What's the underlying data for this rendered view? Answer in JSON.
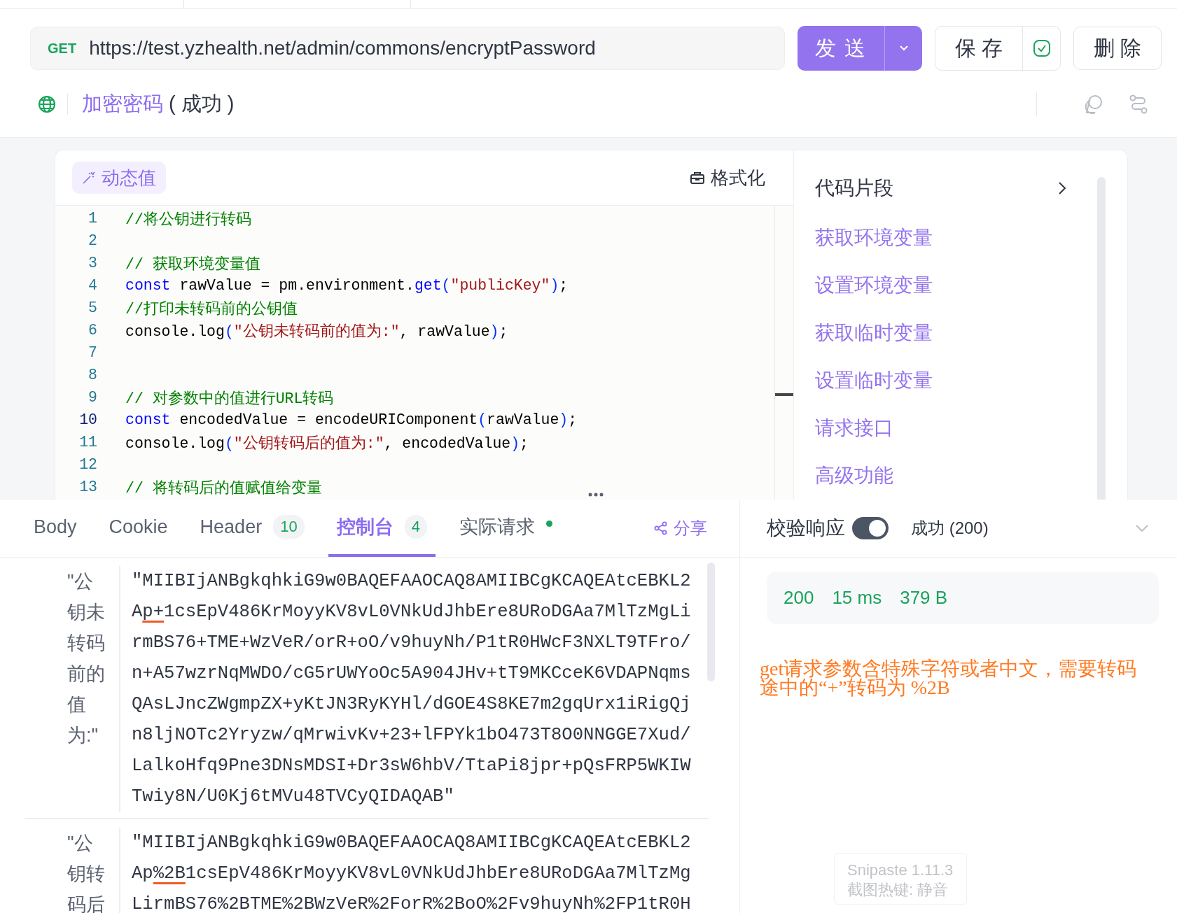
{
  "request": {
    "method": "GET",
    "url": "https://test.yzhealth.net/admin/commons/encryptPassword",
    "send_label": "发 送",
    "save_label": "保 存",
    "delete_label": "删 除",
    "saved": true
  },
  "title": {
    "name": "加密密码",
    "status": "( 成功 )"
  },
  "editor": {
    "dynamic_label": "动态值",
    "format_label": "格式化",
    "lines": [
      {
        "number": "1",
        "current": false,
        "tokens": [
          {
            "kind": "comment",
            "text": "//将公钥进行转码"
          }
        ]
      },
      {
        "number": "2",
        "current": false
      },
      {
        "number": "3",
        "current": false,
        "tokens": [
          {
            "kind": "comment",
            "text": "// 获取环境变量值"
          }
        ]
      },
      {
        "number": "4",
        "current": false,
        "tokens": [
          {
            "kind": "keyword",
            "text": "const"
          },
          {
            "kind": "plain",
            "text": " rawValue = pm.environment."
          },
          {
            "kind": "func",
            "text": "get"
          },
          {
            "kind": "paren",
            "text": "("
          },
          {
            "kind": "string",
            "text": "\"publicKey\""
          },
          {
            "kind": "paren",
            "text": ")"
          },
          {
            "kind": "plain",
            "text": ";"
          }
        ]
      },
      {
        "number": "5",
        "current": false,
        "tokens": [
          {
            "kind": "comment",
            "text": "//打印未转码前的公钥值"
          }
        ]
      },
      {
        "number": "6",
        "current": false,
        "tokens": [
          {
            "kind": "plain",
            "text": "console.log"
          },
          {
            "kind": "paren",
            "text": "("
          },
          {
            "kind": "string",
            "text": "\"公钥未转码前的值为:\""
          },
          {
            "kind": "plain",
            "text": ", rawValue"
          },
          {
            "kind": "paren",
            "text": ")"
          },
          {
            "kind": "plain",
            "text": ";"
          }
        ]
      },
      {
        "number": "7",
        "current": false
      },
      {
        "number": "8",
        "current": false
      },
      {
        "number": "9",
        "current": false,
        "tokens": [
          {
            "kind": "comment",
            "text": "// 对参数中的值进行URL转码"
          }
        ]
      },
      {
        "number": "10",
        "current": true,
        "tokens": [
          {
            "kind": "keyword",
            "text": "const"
          },
          {
            "kind": "plain",
            "text": " encodedValue = encodeURIComponent"
          },
          {
            "kind": "paren",
            "text": "("
          },
          {
            "kind": "plain",
            "text": "rawValue"
          },
          {
            "kind": "paren",
            "text": ")"
          },
          {
            "kind": "plain",
            "text": ";"
          }
        ]
      },
      {
        "number": "11",
        "current": false,
        "tokens": [
          {
            "kind": "plain",
            "text": "console.log"
          },
          {
            "kind": "paren",
            "text": "("
          },
          {
            "kind": "string",
            "text": "\"公钥转码后的值为:\""
          },
          {
            "kind": "plain",
            "text": ", encodedValue"
          },
          {
            "kind": "paren",
            "text": ")"
          },
          {
            "kind": "plain",
            "text": ";"
          }
        ]
      },
      {
        "number": "12",
        "current": false
      },
      {
        "number": "13",
        "current": false,
        "tokens": [
          {
            "kind": "comment",
            "text": "// 将转码后的值赋值给变量"
          }
        ]
      }
    ]
  },
  "snippets": {
    "title": "代码片段",
    "items": [
      "获取环境变量",
      "设置环境变量",
      "获取临时变量",
      "设置临时变量",
      "请求接口",
      "高级功能"
    ]
  },
  "response_tabs": [
    {
      "label": "Body",
      "selected": false,
      "dot": false
    },
    {
      "label": "Cookie",
      "selected": false,
      "dot": false
    },
    {
      "label": "Header",
      "badge": "10",
      "selected": false,
      "dot": false
    },
    {
      "label": "控制台",
      "badge": "4",
      "selected": true,
      "dot": false
    },
    {
      "label": "实际请求",
      "selected": false,
      "dot": true
    }
  ],
  "share_label": "分享",
  "console": [
    {
      "label": "\"公钥未转码前的值为:\"",
      "segments": [
        {
          "kind": "plain",
          "text": "\"MIIBIjANBgkqhkiG9w0BAQEFAAOCAQ8AMIIBCgKCAQEAtcEBKL2A"
        },
        {
          "kind": "underlined",
          "text": "p+"
        },
        {
          "kind": "plain",
          "text": "1csEpV486KrMoyyKV8vL0VNkUdJhbEre8URoDGAa7MlTzMgLirmBS76+TME+WzVeR/orR+oO/v9huyNh/P1tR0HWcF3NXLT9TFro/n+A57wzrNqMWDO/cG5rUWYoOc5A904JHv+tT9MKCceK6VDAPNqmsQAsLJncZWgmpZX+yKtJN3RyKYHl/dGOE4S8KE7m2gqUrx1iRigQjn8ljNOTc2Yryzw/qMrwivKv+23+lFPYk1bO473T8O0NNGGE7Xud/LalkoHfq9Pne3DNsMDSI+Dr3sW6hbV/TtaPi8jpr+pQsFRP5WKIWTwiy8N/U0Kj6tMVu48TVCyQIDAQAB\""
        }
      ]
    },
    {
      "label": "\"公钥转码后",
      "segments": [
        {
          "kind": "plain",
          "text": "\"MIIBIjANBgkqhkiG9w0BAQEFAAOCAQ8AMIIBCgKCAQEAtcEBKL2Ap"
        },
        {
          "kind": "underlined",
          "text": "%2B"
        },
        {
          "kind": "plain",
          "text": "1csEpV486KrMoyyKV8vL0VNkUdJhbEre8URoDGAa7MlTzMgLirmBS76%2BTME%2BWzVeR%2ForR%2BoO%2Fv9huyNh%2FP1tR0H"
        }
      ]
    }
  ],
  "validation": {
    "label": "校验响应",
    "on": true,
    "result": "成功 (200)"
  },
  "stats": [
    "200",
    "15 ms",
    "379 B"
  ],
  "annotation": "get请求参数含特殊字符或者中文，需要转码途中的“+”转码为 %2B",
  "tooltip": {
    "title": "Snipaste 1.11.3",
    "hotkey": "截图热键: 静音"
  }
}
